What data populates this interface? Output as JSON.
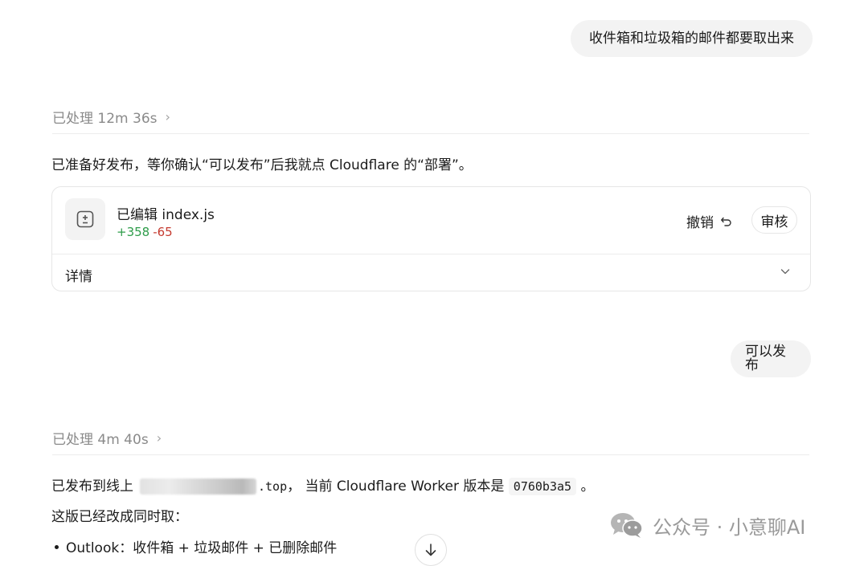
{
  "conversation": {
    "user_message_1": "收件箱和垃圾箱的邮件都要取出来",
    "processed_1": {
      "label": "已处理 12m 36s",
      "chevron": "›"
    },
    "assistant_message_1": "已准备好发布，等你确认“可以发布”后我就点 Cloudflare 的“部署”。",
    "edit_card": {
      "icon": "plus-minus-file-icon",
      "file_title": "已编辑 index.js",
      "additions": "+358",
      "deletions": "-65",
      "undo_label": "撤销",
      "review_label": "审核",
      "details_label": "详情"
    },
    "user_message_2": "可以发布",
    "processed_2": {
      "label": "已处理 4m 40s",
      "chevron": "›"
    },
    "assistant_message_2": {
      "prefix": "已发布到线上",
      "domain_suffix": ".top",
      "middle": "， 当前 Cloudflare Worker 版本是",
      "version": "0760b3a5",
      "end": "。"
    },
    "intro_line": "这版已经改成同时取：",
    "list_items": [
      "Outlook：收件箱 + 垃圾邮件 + 已删除邮件"
    ]
  },
  "watermark": {
    "text": "公众号 · 小意聊AI",
    "icon": "wechat-icon"
  },
  "colors": {
    "addition": "#2e9c4a",
    "deletion": "#c53a2f",
    "bubble": "#f3f3f3"
  }
}
